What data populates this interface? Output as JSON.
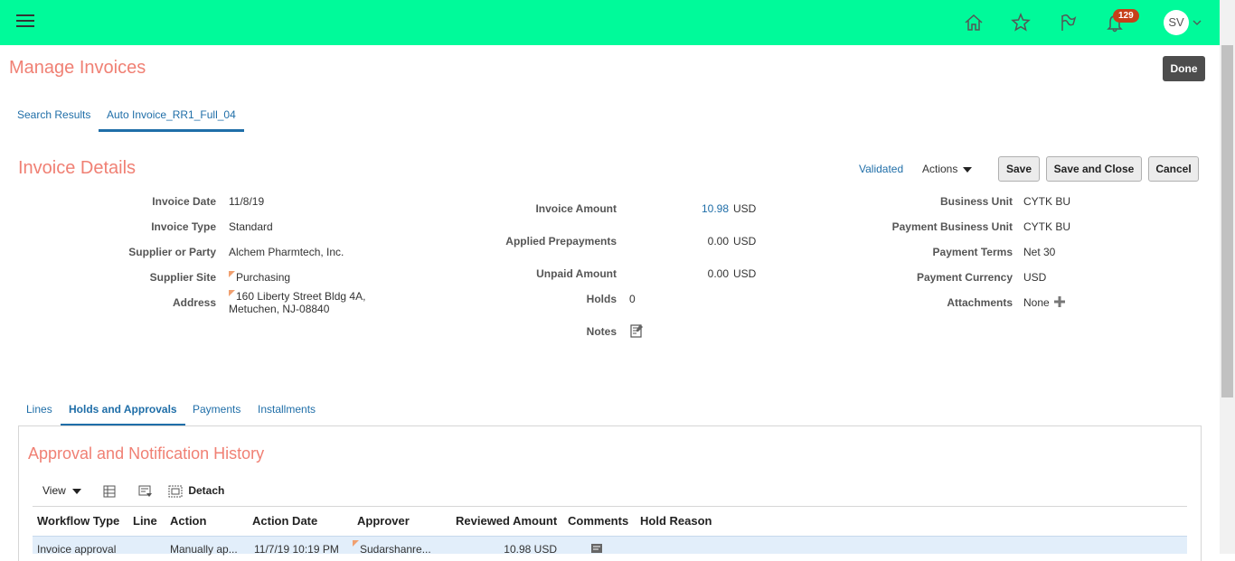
{
  "header": {
    "menu_icon": "hamburger-icon",
    "icons": [
      "home-icon",
      "star-icon",
      "flag-icon",
      "bell-icon"
    ],
    "notification_count": "129",
    "user_initials": "SV",
    "accent_color": "#00fa9a"
  },
  "page": {
    "title": "Manage Invoices",
    "done_label": "Done"
  },
  "top_tabs": [
    {
      "label": "Search Results"
    },
    {
      "label": "Auto Invoice_RR1_Full_04"
    }
  ],
  "invoice": {
    "section_title": "Invoice Details",
    "status": "Validated",
    "actions_label": "Actions",
    "save_label": "Save",
    "save_close_label": "Save and Close",
    "cancel_label": "Cancel",
    "col1": {
      "invoice_date_label": "Invoice Date",
      "invoice_date": "11/8/19",
      "invoice_type_label": "Invoice Type",
      "invoice_type": "Standard",
      "supplier_label": "Supplier or Party",
      "supplier": "Alchem Pharmtech, Inc.",
      "supplier_site_label": "Supplier Site",
      "supplier_site": "Purchasing",
      "address_label": "Address",
      "address_line1": "160 Liberty Street Bldg 4A,",
      "address_line2": "Metuchen, NJ-08840"
    },
    "col2": {
      "invoice_amount_label": "Invoice Amount",
      "invoice_amount": "10.98",
      "invoice_amount_currency": "USD",
      "applied_prepayments_label": "Applied Prepayments",
      "applied_prepayments": "0.00",
      "applied_prepayments_currency": "USD",
      "unpaid_amount_label": "Unpaid Amount",
      "unpaid_amount": "0.00",
      "unpaid_amount_currency": "USD",
      "holds_label": "Holds",
      "holds": "0",
      "notes_label": "Notes"
    },
    "col3": {
      "business_unit_label": "Business Unit",
      "business_unit": "CYTK BU",
      "payment_bu_label": "Payment Business Unit",
      "payment_bu": "CYTK BU",
      "payment_terms_label": "Payment Terms",
      "payment_terms": "Net 30",
      "payment_currency_label": "Payment Currency",
      "payment_currency": "USD",
      "attachments_label": "Attachments",
      "attachments": "None"
    }
  },
  "lower_tabs": [
    {
      "label": "Lines"
    },
    {
      "label": "Holds and Approvals"
    },
    {
      "label": "Payments"
    },
    {
      "label": "Installments"
    }
  ],
  "approval": {
    "title": "Approval and Notification History",
    "view_label": "View",
    "detach_label": "Detach",
    "columns": [
      "Workflow Type",
      "Line",
      "Action",
      "Action Date",
      "Approver",
      "Reviewed Amount",
      "Comments",
      "Hold Reason"
    ],
    "rows": [
      {
        "workflow_type": "Invoice approval",
        "line": "",
        "action": "Manually ap...",
        "action_date": "11/7/19 10:19 PM",
        "approver": "Sudarshanre...",
        "reviewed_amount": "10.98 USD",
        "hold_reason": ""
      }
    ]
  }
}
